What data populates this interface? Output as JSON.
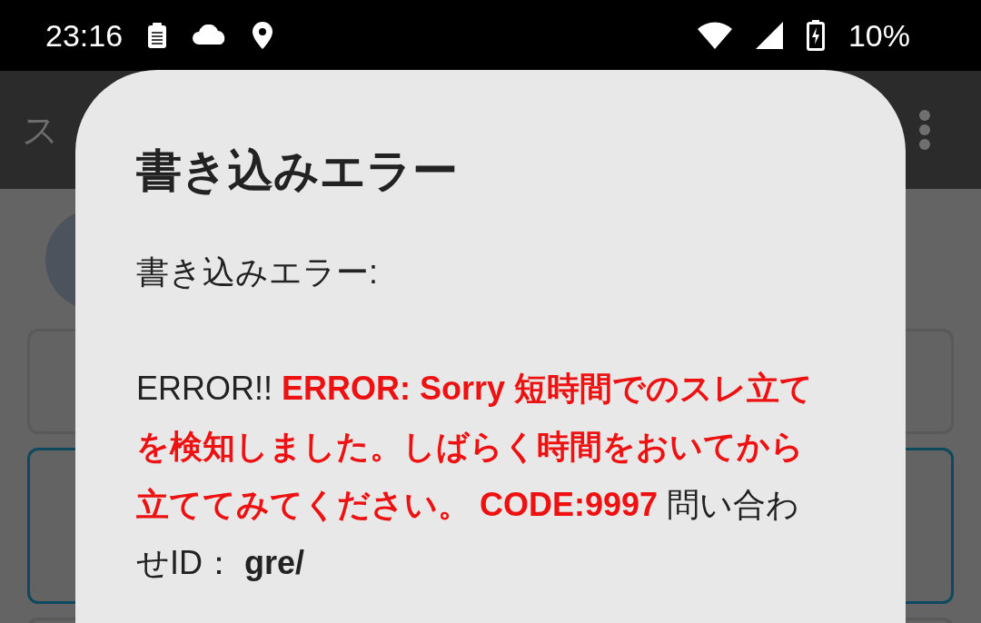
{
  "status_bar": {
    "time": "23:16",
    "battery": "10%"
  },
  "app_bar": {
    "title": "ス"
  },
  "form": {
    "fields": [
      {
        "kind": "short",
        "focused": false
      },
      {
        "kind": "tall",
        "focused": true
      }
    ]
  },
  "dialog": {
    "title": "書き込みエラー",
    "lines": [
      "書き込みエラー:"
    ],
    "message": [
      {
        "kind": "plain",
        "text": "ERROR!! "
      },
      {
        "kind": "error",
        "text": "ERROR: Sorry 短時間でのスレ立てを検知しました。しばらく時間をおいてから立ててみてください。 CODE:9997"
      },
      {
        "kind": "plain",
        "text": " 問い合わせID： "
      },
      {
        "kind": "bold",
        "text": "gre/"
      }
    ]
  }
}
